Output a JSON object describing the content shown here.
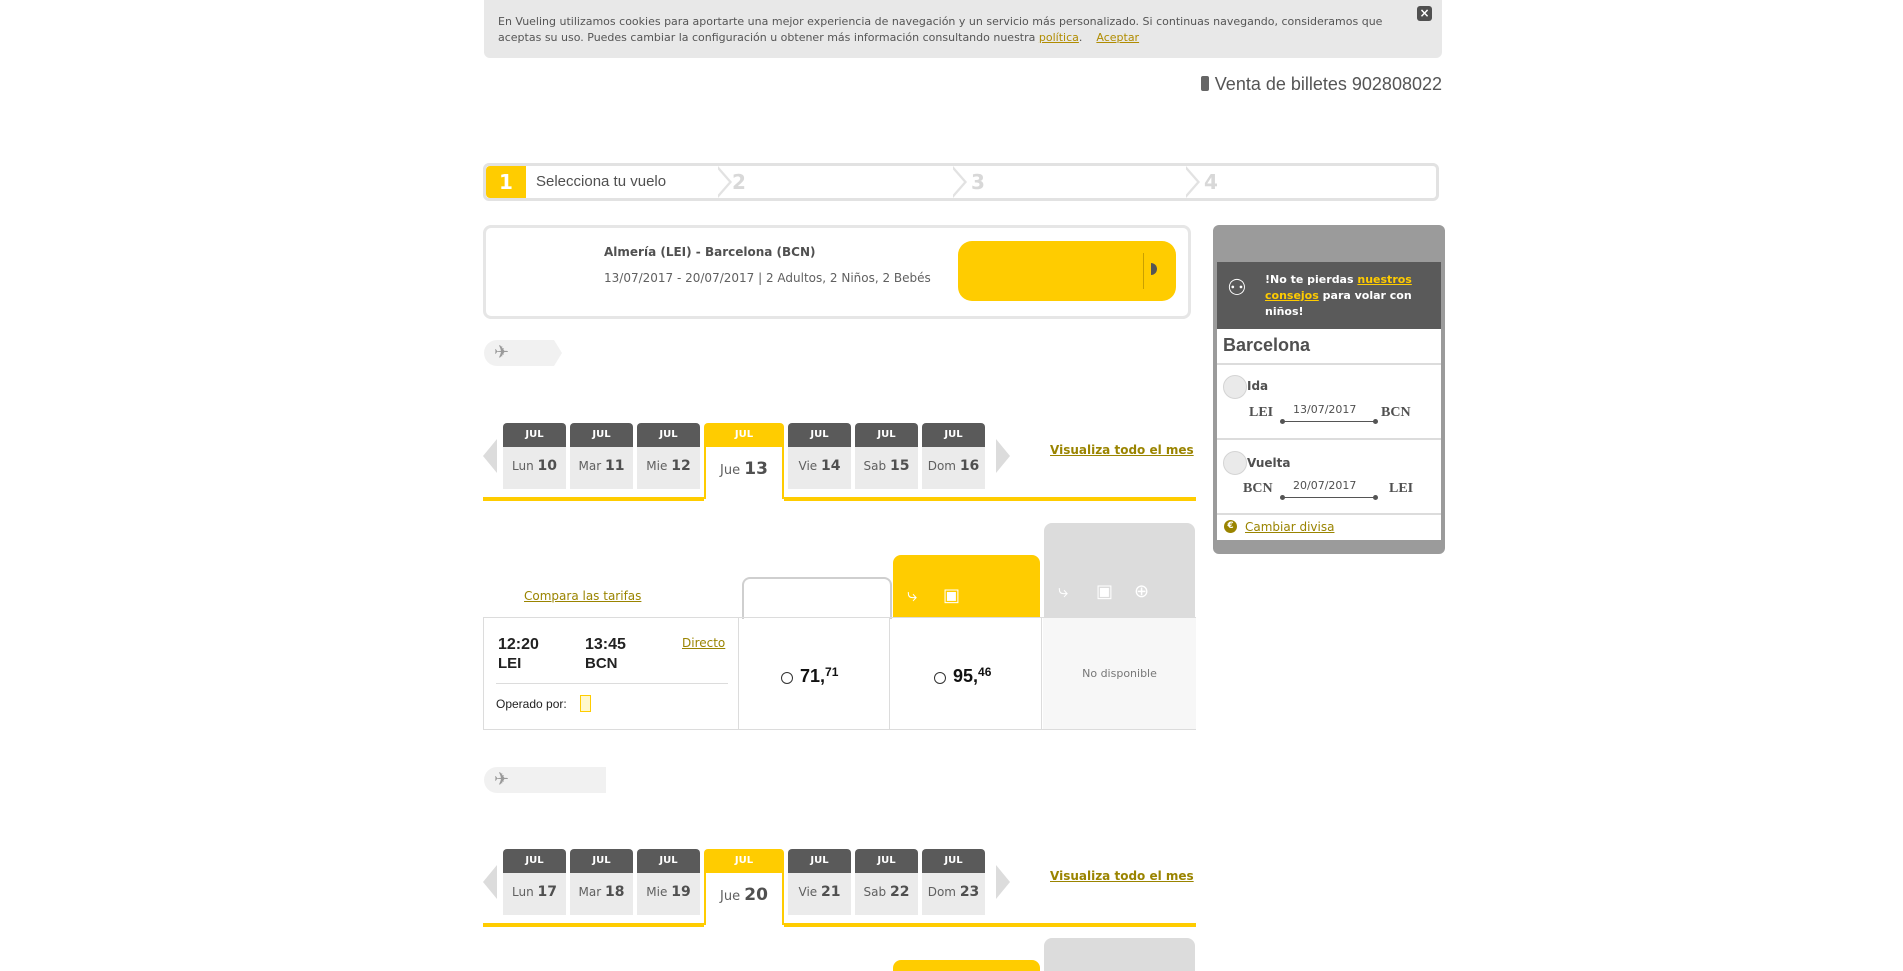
{
  "cookie": {
    "text": "En Vueling utilizamos cookies para aportarte una mejor experiencia de navegación y un servicio más personalizado. Si continuas navegando, consideramos que aceptas su uso. Puedes cambiar la configuración u obtener más información consultando nuestra",
    "policy_link": "política",
    "period": ".",
    "accept_link": "Aceptar",
    "close_label": "×"
  },
  "phone": {
    "label": "Venta de billetes 902808022"
  },
  "steps": [
    {
      "num": "1",
      "label": "Selecciona tu vuelo"
    },
    {
      "num": "2"
    },
    {
      "num": "3"
    },
    {
      "num": "4"
    }
  ],
  "search": {
    "route": "Almería (LEI) - Barcelona (BCN)",
    "dates_pax": "13/07/2017 - 20/07/2017 | 2 Adultos, 2 Niños, 2 Bebés"
  },
  "outbound": {
    "see_month": "Visualiza todo el mes",
    "days": [
      {
        "month": "JUL",
        "weekday": "Lun",
        "day": "10"
      },
      {
        "month": "JUL",
        "weekday": "Mar",
        "day": "11"
      },
      {
        "month": "JUL",
        "weekday": "Mie",
        "day": "12"
      },
      {
        "month": "JUL",
        "weekday": "Jue",
        "day": "13"
      },
      {
        "month": "JUL",
        "weekday": "Vie",
        "day": "14"
      },
      {
        "month": "JUL",
        "weekday": "Sab",
        "day": "15"
      },
      {
        "month": "JUL",
        "weekday": "Dom",
        "day": "16"
      }
    ]
  },
  "fares": {
    "compare": "Compara las tarifas",
    "flight": {
      "dep_time": "12:20",
      "dep_code": "LEI",
      "arr_time": "13:45",
      "arr_code": "BCN",
      "direct": "Directo",
      "operated": "Operado por:",
      "basic_int": "71,",
      "basic_dec": "71",
      "optima_int": "95,",
      "optima_dec": "46",
      "unavailable": "No disponible"
    }
  },
  "return": {
    "see_month": "Visualiza todo el mes",
    "days": [
      {
        "month": "JUL",
        "weekday": "Lun",
        "day": "17"
      },
      {
        "month": "JUL",
        "weekday": "Mar",
        "day": "18"
      },
      {
        "month": "JUL",
        "weekday": "Mie",
        "day": "19"
      },
      {
        "month": "JUL",
        "weekday": "Jue",
        "day": "20"
      },
      {
        "month": "JUL",
        "weekday": "Vie",
        "day": "21"
      },
      {
        "month": "JUL",
        "weekday": "Sab",
        "day": "22"
      },
      {
        "month": "JUL",
        "weekday": "Dom",
        "day": "23"
      }
    ]
  },
  "sidebar": {
    "promo_prefix": "!No te pierdas",
    "promo_link": "nuestros consejos",
    "promo_suffix": "para volar con niños!",
    "city": "Barcelona",
    "outbound": {
      "label": "Ida",
      "from": "LEI",
      "date": "13/07/2017",
      "to": "BCN"
    },
    "inbound": {
      "label": "Vuelta",
      "from": "BCN",
      "date": "20/07/2017",
      "to": "LEI"
    },
    "currency_icon": "€",
    "currency_link": "Cambiar divisa"
  },
  "colors": {
    "accent": "#ffcc00",
    "dark": "#5a5a5a",
    "link": "#9a8400"
  },
  "icons": [
    "phone-icon",
    "close-icon",
    "plane-icon",
    "seat-icon",
    "luggage-icon",
    "plus-icon",
    "family-icon",
    "euro-icon",
    "chevron-left-icon",
    "chevron-right-icon",
    "arrow-right-icon"
  ]
}
